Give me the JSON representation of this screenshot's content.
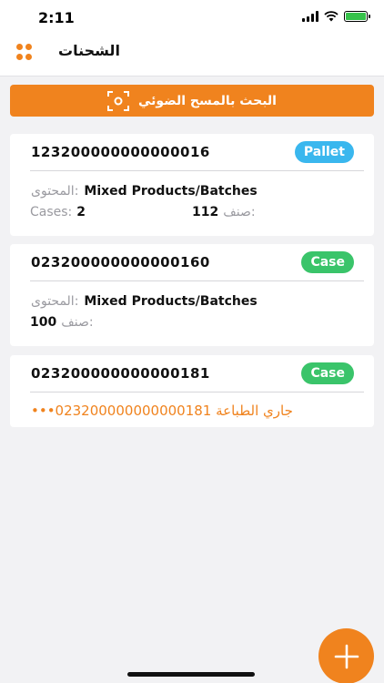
{
  "status": {
    "time": "2:11"
  },
  "header": {
    "title": "الشحنات"
  },
  "scan_button": {
    "label": "البحث بالمسح الضوئي"
  },
  "shipments": [
    {
      "code": "123200000000000016",
      "type": "Pallet",
      "content_label": "المحتوى:",
      "content_value": "Mixed Products/Batches",
      "cases_label": "Cases:",
      "cases_value": "2",
      "sku_label": "صنف:",
      "sku_value": "112"
    },
    {
      "code": "023200000000000160",
      "type": "Case",
      "content_label": "المحتوى:",
      "content_value": "Mixed Products/Batches",
      "sku_label": "صنف:",
      "sku_value": "100"
    },
    {
      "code": "023200000000000181",
      "type": "Case",
      "printing_text": "•••جاري الطباعة 023200000000000181"
    }
  ],
  "colors": {
    "accent": "#f0831e",
    "pallet_badge": "#3ab7ee",
    "case_badge": "#3ac46a"
  },
  "icons": {
    "menu": "grid-dots-icon",
    "scan": "scan-frame-icon",
    "fab": "plus-icon"
  }
}
